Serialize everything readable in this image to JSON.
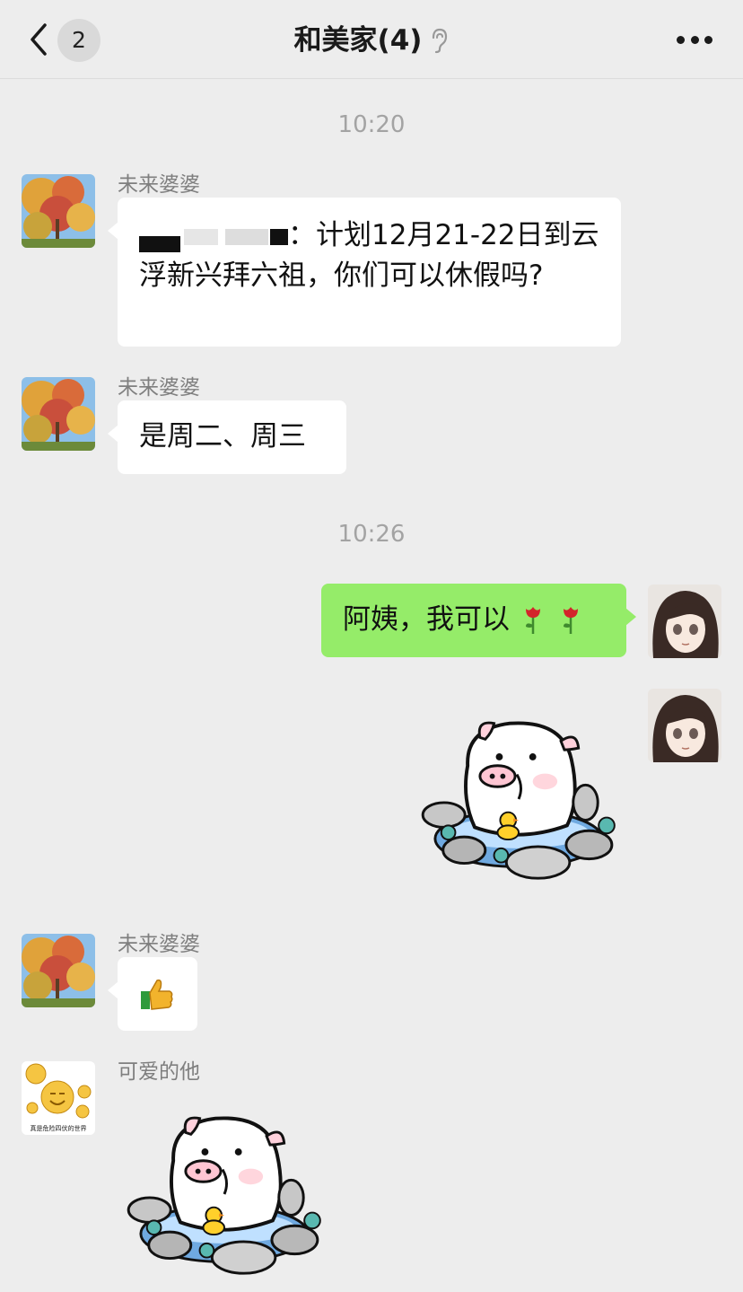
{
  "header": {
    "back_count": "2",
    "title": "和美家(4)"
  },
  "colors": {
    "background": "#ededed",
    "bubble_incoming": "#ffffff",
    "bubble_outgoing": "#95ec69",
    "timestamp": "#a3a3a3"
  },
  "messages": [
    {
      "type": "timestamp",
      "text": "10:20"
    },
    {
      "type": "incoming",
      "sender": "未来婆婆",
      "text": "：计划12月21-22日到云浮新兴拜六祖，你们可以休假吗?"
    },
    {
      "type": "incoming",
      "sender": "未来婆婆",
      "text": "是周二、周三"
    },
    {
      "type": "timestamp",
      "text": "10:26"
    },
    {
      "type": "outgoing",
      "text": "阿姨，我可以",
      "emoji": [
        "rose-emoji",
        "rose-emoji"
      ]
    },
    {
      "type": "outgoing-sticker",
      "sticker": "pig-in-hot-spring-sticker"
    },
    {
      "type": "incoming",
      "sender": "未来婆婆",
      "emoji": [
        "thumbs-up-emoji"
      ]
    },
    {
      "type": "incoming-sticker",
      "sender": "可爱的他",
      "sticker": "pig-in-hot-spring-sticker"
    }
  ],
  "avatars": {
    "future_mother_in_law": "autumn-tree-avatar",
    "me": "anime-girl-avatar",
    "boyfriend": "smiley-faces-avatar",
    "boyfriend_avatar_caption": "真是危险四伏的世界"
  }
}
